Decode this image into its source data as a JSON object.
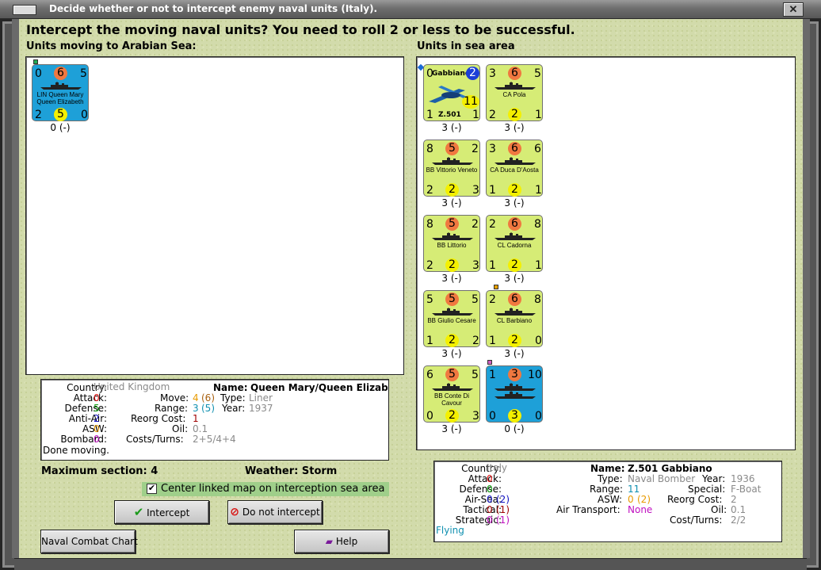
{
  "window": {
    "title": "Decide whether or not to intercept enemy naval units (Italy)."
  },
  "header": {
    "question": "Intercept the moving naval units?  You need to roll 2 or less to be successful."
  },
  "moving": {
    "label": "Units moving to Arabian Sea:",
    "units": [
      {
        "tl": "0",
        "circle_top": "6",
        "tr": "5",
        "name": "LIN Queen Mary Queen Elizabeth",
        "bl": "2",
        "circle_bot": "5",
        "br": "0",
        "under": "0 (-)",
        "color": "blue"
      }
    ]
  },
  "sea": {
    "label": "Units in sea area",
    "units": [
      {
        "tl": "0",
        "name_top": "Gabbiano",
        "circle_top": "2",
        "mid": "11",
        "name": "Z.501",
        "bl": "1",
        "br": "1",
        "under": "3 (-)",
        "color": "green"
      },
      {
        "tl": "3",
        "circle_top": "6",
        "tr": "5",
        "name": "CA Pola",
        "bl": "2",
        "circle_bot": "2",
        "br": "1",
        "under": "3 (-)",
        "color": "green"
      },
      {
        "tl": "8",
        "circle_top": "5",
        "tr": "2",
        "name": "BB Vittorio Veneto",
        "bl": "2",
        "circle_bot": "2",
        "br": "3",
        "under": "3 (-)",
        "color": "green"
      },
      {
        "tl": "3",
        "circle_top": "6",
        "tr": "6",
        "name": "CA Duca D'Aosta",
        "bl": "1",
        "circle_bot": "2",
        "br": "1",
        "under": "3 (-)",
        "color": "green"
      },
      {
        "tl": "8",
        "circle_top": "5",
        "tr": "2",
        "name": "BB Littorio",
        "bl": "2",
        "circle_bot": "2",
        "br": "3",
        "under": "3 (-)",
        "color": "green"
      },
      {
        "tl": "2",
        "circle_top": "6",
        "tr": "8",
        "name": "CL Cadorna",
        "bl": "1",
        "circle_bot": "2",
        "br": "1",
        "under": "3 (-)",
        "color": "green"
      },
      {
        "tl": "5",
        "circle_top": "5",
        "tr": "5",
        "name": "BB Giulio Cesare",
        "bl": "1",
        "circle_bot": "2",
        "br": "2",
        "under": "3 (-)",
        "color": "green"
      },
      {
        "tl": "2",
        "circle_top": "6",
        "tr": "8",
        "name": "CL Barbiano",
        "bl": "1",
        "circle_bot": "2",
        "br": "0",
        "under": "3 (-)",
        "color": "green"
      },
      {
        "tl": "6",
        "circle_top": "5",
        "tr": "5",
        "name": "BB Conte Di Cavour",
        "bl": "0",
        "circle_bot": "2",
        "br": "3",
        "under": "3 (-)",
        "color": "green"
      },
      {
        "tl": "1",
        "circle_top": "3",
        "tr": "10",
        "name": "",
        "bl": "0",
        "circle_bot": "3",
        "br": "0",
        "under": "0 (-)",
        "color": "blue"
      }
    ]
  },
  "left_info": {
    "country_label": "Country:",
    "country": "United Kingdom",
    "attack_label": "Attack:",
    "attack": "0",
    "defense_label": "Defense:",
    "defense": "5",
    "antiair_label": "Anti-Air:",
    "antiair": "2",
    "asw_label": "ASW:",
    "asw": "0",
    "bombard_label": "Bombard:",
    "bombard": "0",
    "status": "Done moving.",
    "name_label": "Name:",
    "name": "Queen Mary/Queen Elizab",
    "move_label": "Move:",
    "move": "4",
    "move_paren": "(6)",
    "type_label": "Type:",
    "type": "Liner",
    "range_label": "Range:",
    "range": "3",
    "range_paren": "(5)",
    "year_label": "Year:",
    "year": "1937",
    "reorg_label": "Reorg Cost:",
    "reorg": "1",
    "oil_label": "Oil:",
    "oil": "0.1",
    "costs_label": "Costs/Turns:",
    "costs": "2+5/4+4"
  },
  "max_section": "Maximum section: 4",
  "weather": "Weather:  Storm",
  "center_checkbox": {
    "label": "Center linked map on interception sea area",
    "checked": true,
    "mark": "✔"
  },
  "buttons": {
    "intercept": "Intercept",
    "no_intercept": "Do not intercept",
    "combat_chart": "Naval Combat Chart",
    "help": "Help"
  },
  "right_info": {
    "country_label": "Country:",
    "country": "Italy",
    "attack_label": "Attack:",
    "attack": "0",
    "defense_label": "Defense:",
    "defense": "0",
    "airsea_label": "Air-Sea:",
    "airsea": "0",
    "airsea_paren": "(2)",
    "tactical_label": "Tactical:",
    "tactical": "0",
    "tactical_paren": "(1)",
    "strategic_label": "Strategic:",
    "strategic": "0",
    "strategic_paren": "(1)",
    "status": "Flying",
    "name_label": "Name:",
    "name": "Z.501 Gabbiano",
    "type_label": "Type:",
    "type": "Naval Bomber",
    "year_label": "Year:",
    "year": "1936",
    "range_label": "Range:",
    "range": "11",
    "special_label": "Special:",
    "special": "F-Boat",
    "asw_label": "ASW:",
    "asw": "0",
    "asw_paren": "(2)",
    "reorg_label": "Reorg Cost:",
    "reorg": "2",
    "airtransport_label": "Air Transport:",
    "airtransport": "None",
    "oil_label": "Oil:",
    "oil": "0.1",
    "costs_label": "Cost/Turns:",
    "costs": "2/2"
  },
  "colors": {
    "panel": "#d2dbab",
    "counter_green": "#d6ec76",
    "counter_blue": "#1ea0d8",
    "circle_orange": "#f07840",
    "circle_yellow": "#f4f000"
  }
}
